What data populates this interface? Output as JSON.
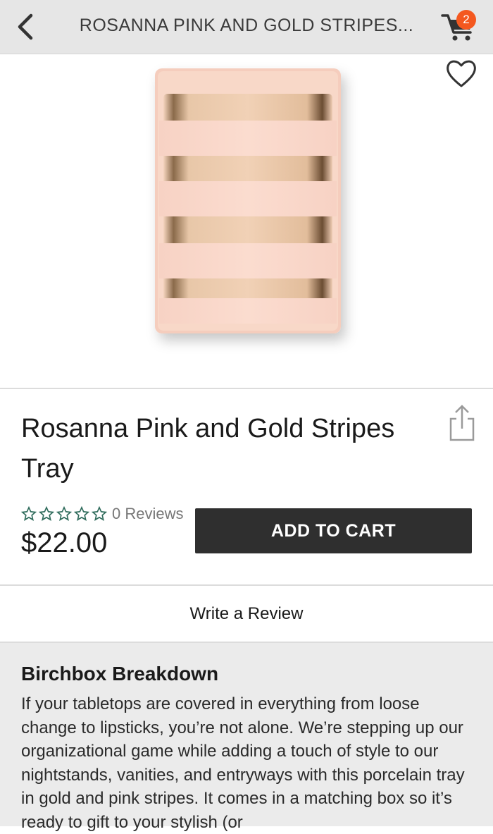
{
  "topbar": {
    "title": "ROSANNA PINK AND GOLD STRIPES...",
    "cart_count": "2",
    "icons": [
      "back-chevron-icon",
      "cart-icon"
    ]
  },
  "product": {
    "image_description_icon": "product-image",
    "title": "Rosanna Pink and Gold Stripes Tray",
    "rating_stars": 0,
    "reviews_label": "0 Reviews",
    "price": "$22.00",
    "add_to_cart_label": "ADD TO CART",
    "icons": [
      "heart-icon",
      "share-icon",
      "star-outline-icon"
    ]
  },
  "review": {
    "write_label": "Write a Review"
  },
  "breakdown": {
    "heading": "Birchbox Breakdown",
    "body": "If your tabletops are covered in everything from loose change to lipsticks, you’re not alone. We’re stepping up our organizational game while adding a touch of style to our nightstands, vanities, and entryways with this porcelain tray in gold and pink stripes. It comes in a matching box so it’s ready to gift to your stylish (or"
  },
  "colors": {
    "topbar_bg": "#e6e6e6",
    "badge": "#f4581f",
    "button_bg": "#2f2f2f",
    "star_outline": "#2e6b5b",
    "breakdown_bg": "#ebebeb"
  }
}
